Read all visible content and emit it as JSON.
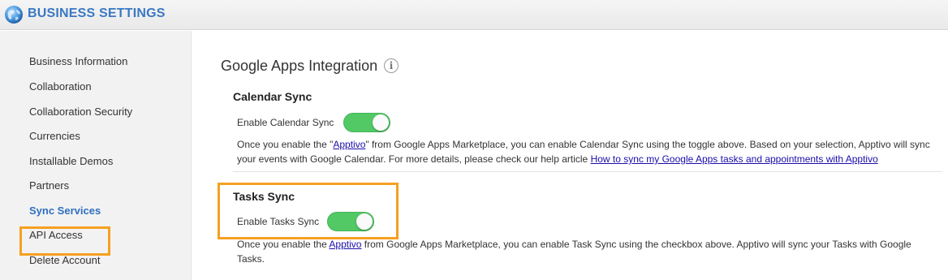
{
  "header": {
    "title": "BUSINESS SETTINGS",
    "logo_icon": "globe-icon"
  },
  "sidebar": {
    "items": [
      {
        "label": "Business Information"
      },
      {
        "label": "Collaboration"
      },
      {
        "label": "Collaboration Security"
      },
      {
        "label": "Currencies"
      },
      {
        "label": "Installable Demos"
      },
      {
        "label": "Partners"
      },
      {
        "label": "Sync Services",
        "active": true
      },
      {
        "label": "API Access"
      },
      {
        "label": "Delete Account"
      }
    ],
    "active_color": "#2f6fc1"
  },
  "main": {
    "heading": "Google Apps Integration",
    "info_icon": "info-icon",
    "calendar": {
      "title": "Calendar Sync",
      "toggle_label": "Enable Calendar Sync",
      "toggle_on": true,
      "desc_1": "Once you enable the \"",
      "link_1": "Apptivo",
      "desc_2": "\" from Google Apps Marketplace, you can enable Calendar Sync using the toggle above. Based on your selection, Apptivo will sync your events with Google Calendar. For more details, please check our help article ",
      "link_2": "How to sync my Google Apps tasks and appointments with Apptivo"
    },
    "tasks": {
      "title": "Tasks Sync",
      "toggle_label": "Enable Tasks Sync",
      "toggle_on": true,
      "desc_1": "Once you enable the ",
      "link_1": "Apptivo",
      "desc_2": " from Google Apps Marketplace, you can enable Task Sync using the checkbox above. Apptivo will sync your Tasks with Google Tasks."
    }
  },
  "colors": {
    "accent": "#3a78c3",
    "toggle_on": "#52c965",
    "highlight": "#f5a021",
    "link": "#1a0dab"
  }
}
